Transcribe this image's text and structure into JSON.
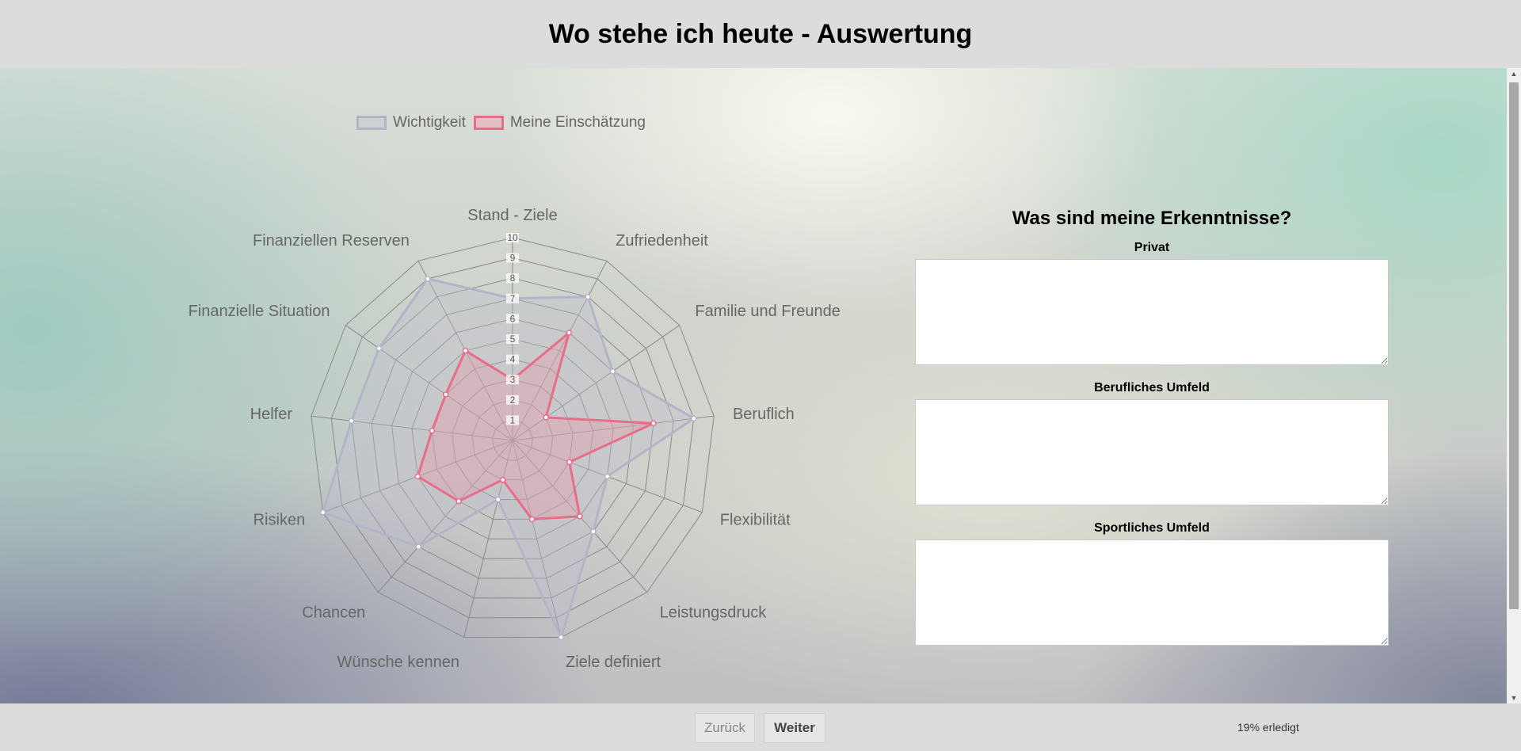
{
  "page": {
    "title": "Wo stehe ich heute - Auswertung"
  },
  "chart_data": {
    "type": "radar",
    "title": "",
    "r_range": [
      0,
      10
    ],
    "ticks": [
      "1",
      "2",
      "3",
      "4",
      "5",
      "6",
      "7",
      "8",
      "9",
      "10"
    ],
    "categories": [
      "Stand - Ziele",
      "Zufriedenheit",
      "Familie und Freunde",
      "Beruflich",
      "Flexibilität",
      "Leistungsdruck",
      "Ziele definiert",
      "Wünsche kennen",
      "Chancen",
      "Risiken",
      "Helfer",
      "Finanzielle Situation",
      "Finanziellen Reserven"
    ],
    "series": [
      {
        "name": "Wichtigkeit",
        "color": "#b4b4c8",
        "fill": "rgba(190,190,205,0.35)",
        "values": [
          7,
          8,
          6,
          9,
          5,
          6,
          10,
          3,
          7,
          10,
          8,
          8,
          9
        ]
      },
      {
        "name": "Meine Einschätzung",
        "color": "#e86d89",
        "fill": "rgba(236,150,165,0.35)",
        "values": [
          3,
          6,
          2,
          7,
          3,
          5,
          4,
          2,
          4,
          5,
          4,
          4,
          5
        ]
      }
    ],
    "legend": "top",
    "grid": true
  },
  "legend": {
    "item_0": "Wichtigkeit",
    "item_1": "Meine Einschätzung"
  },
  "insights": {
    "heading": "Was sind meine Erkenntnisse?",
    "field_0_label": "Privat",
    "field_1_label": "Berufliches Umfeld",
    "field_2_label": "Sportliches Umfeld",
    "field_0_value": "",
    "field_1_value": "",
    "field_2_value": ""
  },
  "footer": {
    "back_label": "Zurück",
    "next_label": "Weiter",
    "progress_text": "19% erledigt"
  },
  "icons": {
    "scroll_up": "arrow-up-icon",
    "scroll_down": "arrow-down-icon"
  }
}
